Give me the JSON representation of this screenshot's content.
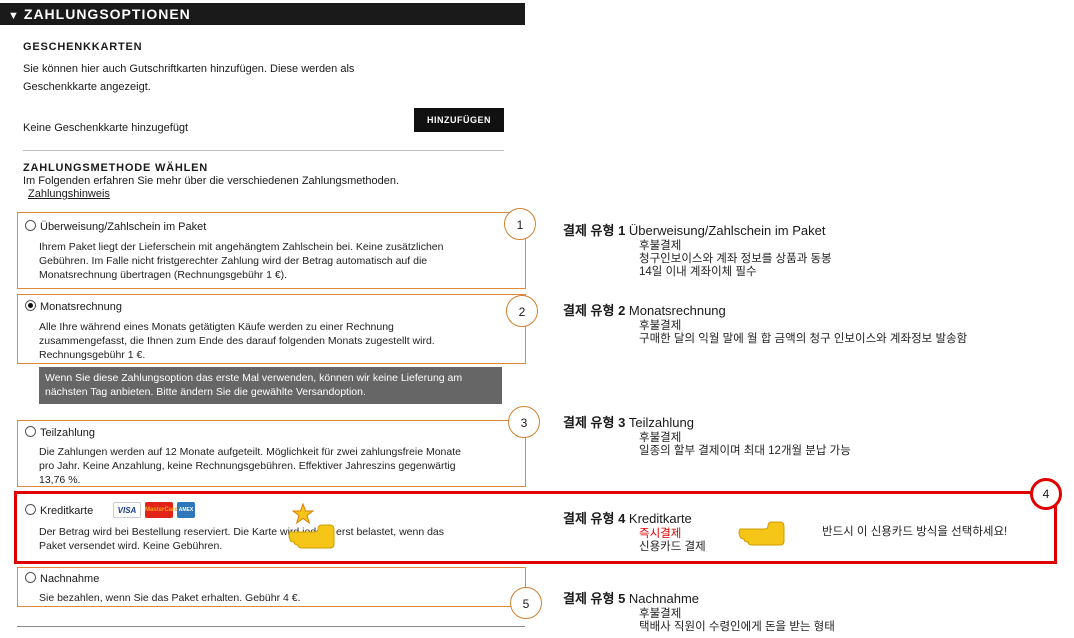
{
  "header": {
    "arrow_icon": "triangle-down-icon",
    "title": "ZAHLUNGSOPTIONEN"
  },
  "gift": {
    "title": "GESCHENKKARTEN",
    "desc_line1": "Sie können hier auch Gutschriftkarten hinzufügen. Diese werden als",
    "desc_line2": "Geschenkkarte angezeigt.",
    "none": "Keine Geschenkkarte hinzugefügt",
    "add_button": "HINZUFÜGEN"
  },
  "method": {
    "title": "ZAHLUNGSMETHODE WÄHLEN",
    "desc": "Im Folgenden erfahren Sie mehr über die verschiedenen Zahlungsmethoden.",
    "link": "Zahlungshinweis"
  },
  "options": [
    {
      "name": "Überweisung/Zahlschein im Paket",
      "selected": false,
      "desc": [
        "Ihrem Paket liegt der Lieferschein mit angehängtem Zahlschein bei. Keine zusätzlichen",
        "Gebühren. Im Falle nicht fristgerechter Zahlung wird der Betrag automatisch auf die",
        "Monatsrechnung übertragen (Rechnungsgebühr 1 €)."
      ]
    },
    {
      "name": "Monatsrechnung",
      "selected": true,
      "desc": [
        "Alle Ihre während eines Monats getätigten Käufe werden zu einer Rechnung",
        "zusammengefasst, die Ihnen zum Ende des darauf folgenden Monats zugestellt wird.",
        "Rechnungsgebühr 1 €."
      ]
    },
    {
      "name": "Teilzahlung",
      "selected": false,
      "desc": [
        "Die Zahlungen werden auf 12 Monate aufgeteilt. Möglichkeit für zwei zahlungsfreie Monate",
        "pro Jahr. Keine Anzahlung, keine Rechnungsgebühren. Effektiver Jahreszins gegenwärtig",
        "13,76 %."
      ]
    },
    {
      "name": "Kreditkarte",
      "selected": false,
      "desc": [
        "Der Betrag wird bei Bestellung reserviert. Die Karte wird jedoch erst belastet, wenn das",
        "Paket versendet wird. Keine Gebühren."
      ],
      "cards": [
        "VISA",
        "MasterCard",
        "AMEX"
      ]
    },
    {
      "name": "Nachnahme",
      "selected": false,
      "desc": [
        "Sie bezahlen, wenn Sie das Paket erhalten. Gebühr 4 €."
      ]
    }
  ],
  "notice": [
    "Wenn Sie diese Zahlungsoption das erste Mal verwenden, können wir keine Lieferung am",
    "nächsten Tag anbieten. Bitte ändern Sie die gewählte Versandoption."
  ],
  "markers": [
    "1",
    "2",
    "3",
    "4",
    "5"
  ],
  "notes": [
    {
      "prefix": "결제 유형 1",
      "name": "Überweisung/Zahlschein im Paket",
      "lines": [
        "후불결제",
        "청구인보이스와 계좌 정보를 상품과 동봉",
        "14일 이내 계좌이체 필수"
      ]
    },
    {
      "prefix": "결제 유형 2",
      "name": "Monatsrechnung",
      "lines": [
        "후불결제",
        "구매한 달의 익월 말에 월 합 금액의 청구 인보이스와 계좌정보 발송함"
      ]
    },
    {
      "prefix": "결제 유형 3",
      "name": "Teilzahlung",
      "lines": [
        "후불결제",
        "일종의 할부 결제이며 최대 12개월 분납 가능"
      ]
    },
    {
      "prefix": "결제 유형 4",
      "name": "Kreditkarte",
      "lines": [
        "즉시결제",
        "신용카드 결제"
      ],
      "extra": "반드시 이 신용카드 방식을 선택하세요!"
    },
    {
      "prefix": "결제 유형 5",
      "name": "Nachnahme",
      "lines": [
        "후불결제",
        "택배사 직원이 수령인에게 돈을 받는 형태"
      ]
    }
  ],
  "colors": {
    "accent_border": "#e0883a",
    "highlight_red": "#e00000",
    "header_bg": "#1a1a1a",
    "hand_yellow": "#f5c518"
  }
}
